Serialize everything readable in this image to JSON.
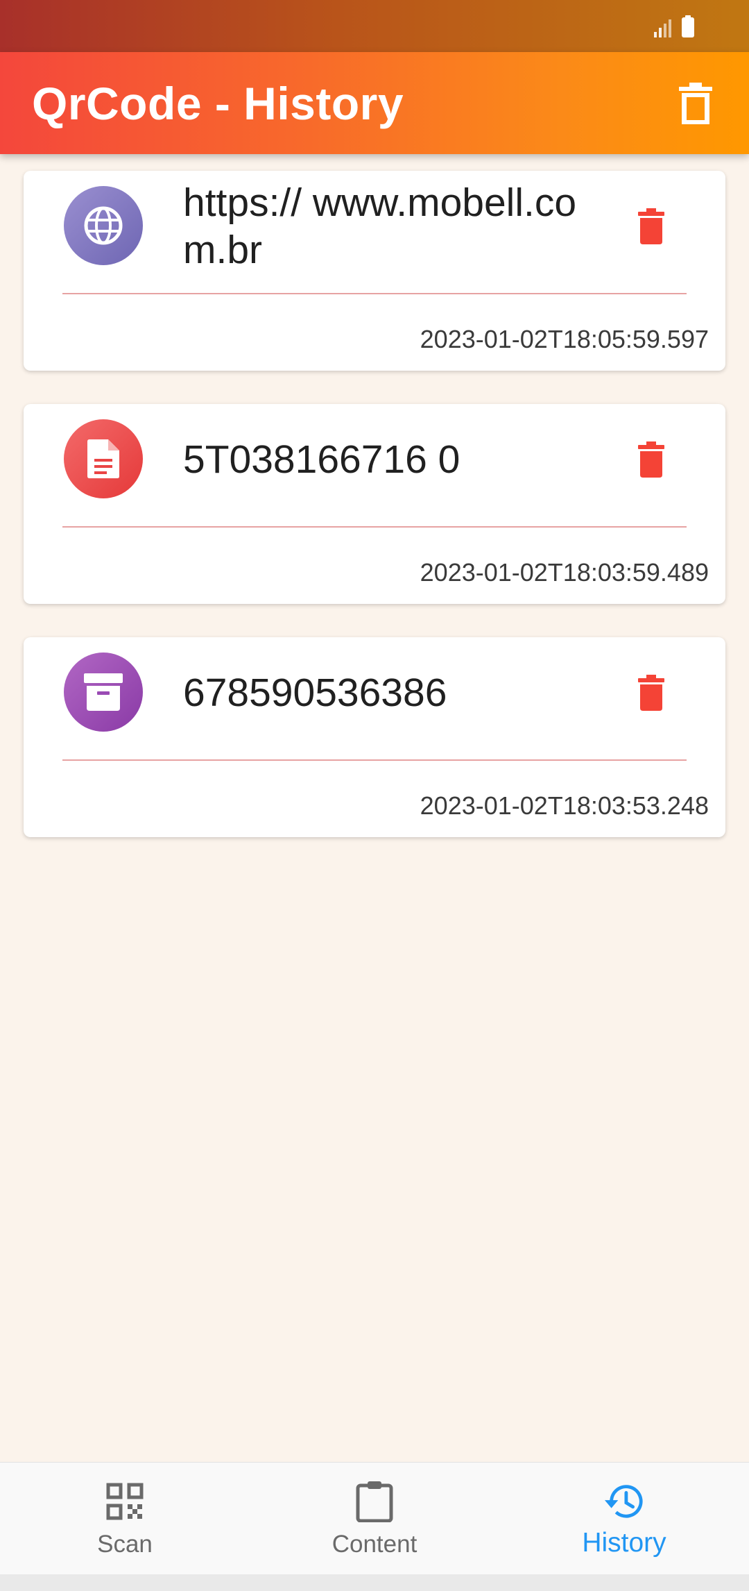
{
  "app_bar": {
    "title": "QrCode - History",
    "clear_icon": "trash-outline-icon"
  },
  "history": {
    "items": [
      {
        "type_icon": "globe-icon",
        "content": "https:// www.mobell.com.br",
        "timestamp": "2023-01-02T18:05:59.597",
        "delete_icon": "trash-icon"
      },
      {
        "type_icon": "document-icon",
        "content": "5T038166716 0",
        "timestamp": "2023-01-02T18:03:59.489",
        "delete_icon": "trash-icon"
      },
      {
        "type_icon": "archive-icon",
        "content": "678590536386",
        "timestamp": "2023-01-02T18:03:53.248",
        "delete_icon": "trash-icon"
      }
    ]
  },
  "bottom_nav": {
    "items": [
      {
        "label": "Scan",
        "icon": "qr-code-icon",
        "active": false
      },
      {
        "label": "Content",
        "icon": "clipboard-icon",
        "active": false
      },
      {
        "label": "History",
        "icon": "history-icon",
        "active": true
      }
    ]
  },
  "colors": {
    "app_bar_start": "#f4473c",
    "app_bar_end": "#ff9800",
    "delete_red": "#f44336",
    "active_blue": "#2196f3",
    "background": "#fbf3eb",
    "divider": "#e7a3a3"
  }
}
